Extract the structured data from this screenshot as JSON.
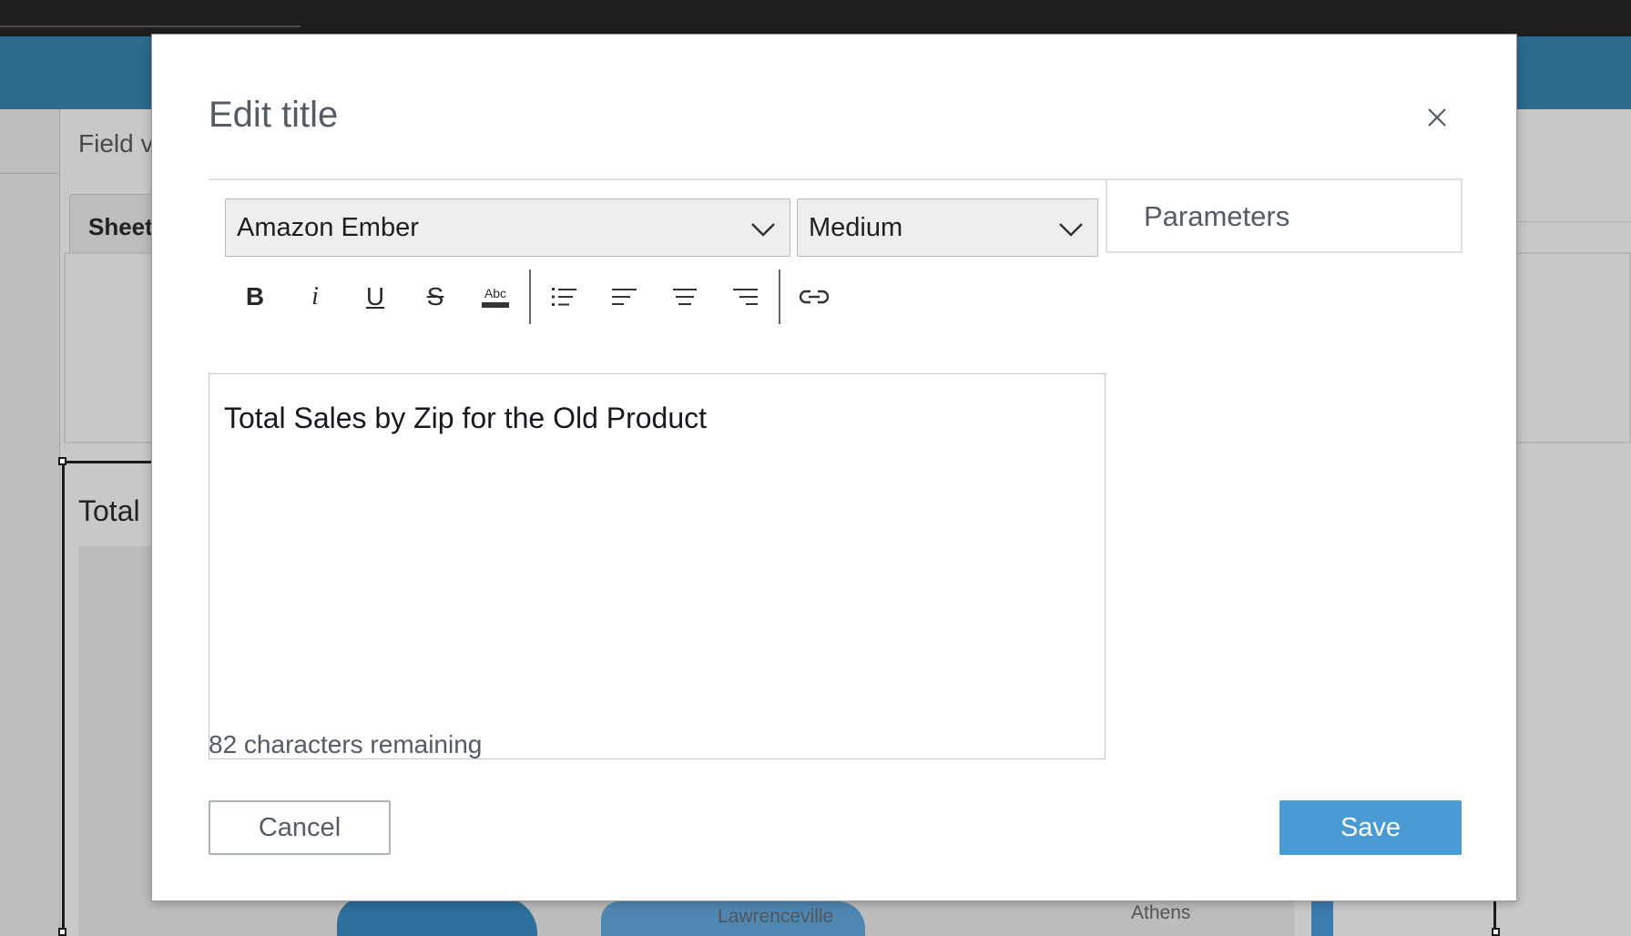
{
  "background": {
    "field_wells_label": "Field v",
    "sheet_tab_label": "Sheet",
    "visual_title": "Total",
    "map_labels": [
      "Lawrenceville",
      "Athens"
    ]
  },
  "dialog": {
    "title": "Edit title",
    "close_icon": "close-icon",
    "font_family_value": "Amazon Ember",
    "font_size_value": "Medium",
    "toolbar": [
      {
        "name": "bold-icon",
        "glyph": "B"
      },
      {
        "name": "italic-icon",
        "glyph": "i"
      },
      {
        "name": "underline-icon",
        "glyph": "U"
      },
      {
        "name": "strikethrough-icon",
        "glyph": "S"
      },
      {
        "name": "text-color-icon",
        "glyph": "Abc"
      },
      {
        "name": "bulleted-list-icon"
      },
      {
        "name": "align-left-icon"
      },
      {
        "name": "align-center-icon"
      },
      {
        "name": "align-right-icon"
      },
      {
        "name": "link-icon"
      }
    ],
    "editor_text": "Total Sales by Zip for the Old Product",
    "characters_remaining": "82 characters remaining",
    "parameters_label": "Parameters",
    "cancel_label": "Cancel",
    "save_label": "Save"
  },
  "colors": {
    "primary_button": "#4a9ad4",
    "header_band": "#2e6a8e",
    "title_text": "#545b64"
  }
}
